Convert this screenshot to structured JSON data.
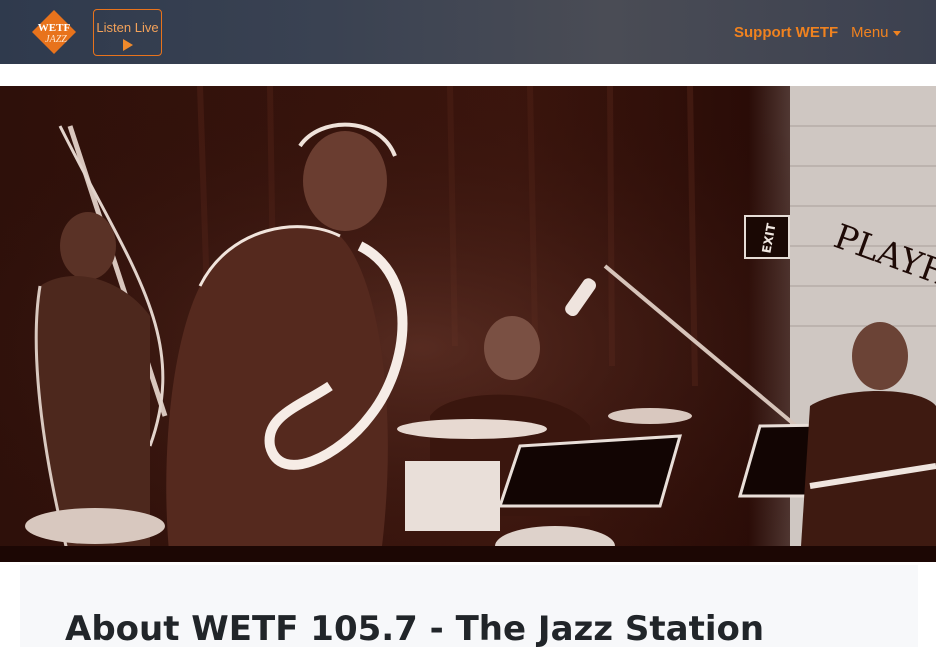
{
  "header": {
    "logo_alt": "WETF JAZZ",
    "logo_text_top": "WETF",
    "logo_text_bottom": "JAZZ",
    "listen_label": "Listen Live",
    "support_label": "Support WETF",
    "menu_label": "Menu"
  },
  "hero": {
    "sign_exit": "EXIT",
    "wall_text": "PLAYH"
  },
  "main": {
    "title": "About WETF 105.7 - The Jazz Station"
  },
  "colors": {
    "accent": "#f0821f",
    "navbar": "#3a4252",
    "hero_tint": "#3b150d"
  }
}
